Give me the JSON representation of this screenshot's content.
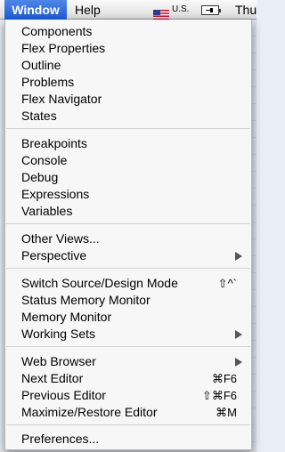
{
  "menubar": {
    "window": "Window",
    "help": "Help",
    "locale": "U.S.",
    "clock": "Thu"
  },
  "colors": {
    "highlight": "#2a64dc",
    "separator": "#d3d3d3"
  },
  "menu": {
    "components": "Components",
    "flex_properties": "Flex Properties",
    "outline": "Outline",
    "problems": "Problems",
    "flex_navigator": "Flex Navigator",
    "states": "States",
    "breakpoints": "Breakpoints",
    "console": "Console",
    "debug": "Debug",
    "expressions": "Expressions",
    "variables": "Variables",
    "other_views": "Other Views...",
    "perspective": "Perspective",
    "switch_source": "Switch Source/Design Mode",
    "switch_source_shortcut": "⇧^`",
    "status_memory_monitor": "Status Memory Monitor",
    "memory_monitor": "Memory Monitor",
    "working_sets": "Working Sets",
    "web_browser": "Web Browser",
    "next_editor": "Next Editor",
    "next_editor_shortcut": "⌘F6",
    "previous_editor": "Previous Editor",
    "previous_editor_shortcut": "⇧⌘F6",
    "maximize_restore_editor": "Maximize/Restore Editor",
    "maximize_restore_editor_shortcut": "⌘M",
    "preferences": "Preferences..."
  }
}
